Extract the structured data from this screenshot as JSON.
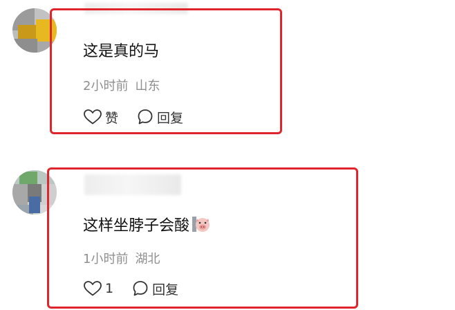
{
  "comments": [
    {
      "text": "这是真的马",
      "time": "2小时前",
      "location": "山东",
      "like_label": "赞",
      "reply_label": "回复"
    },
    {
      "text": "这样坐脖子会酸",
      "time": "1小时前",
      "location": "湖北",
      "like_label": "1",
      "reply_label": "回复",
      "emoji": "pig-face-emoji"
    }
  ],
  "colors": {
    "highlight": "#e0242b",
    "text": "#111111",
    "meta": "#8f8f8f"
  },
  "icons": [
    "heart-icon",
    "speech-bubble-icon"
  ]
}
